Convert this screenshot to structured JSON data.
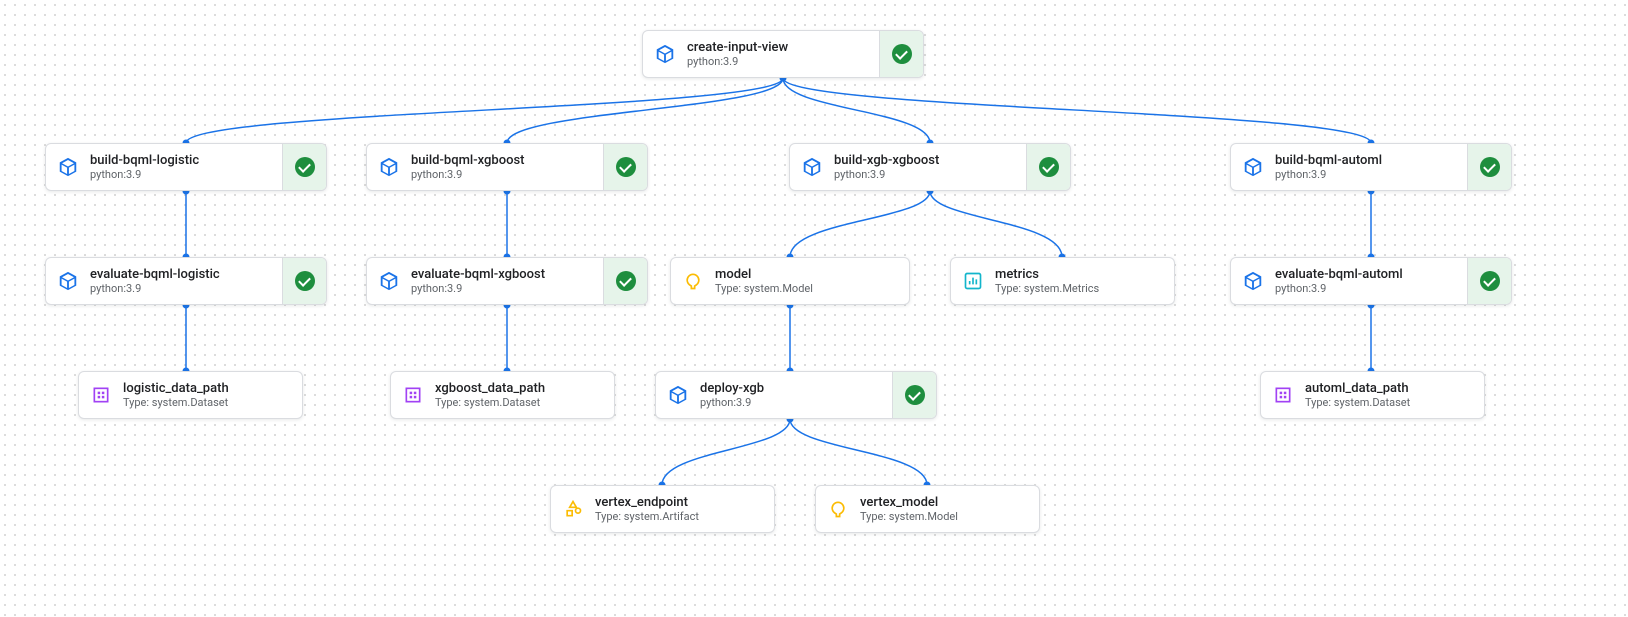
{
  "nodes": {
    "create_input_view": {
      "title": "create-input-view",
      "subtitle": "python:3.9"
    },
    "build_bqml_logistic": {
      "title": "build-bqml-logistic",
      "subtitle": "python:3.9"
    },
    "build_bqml_xgboost": {
      "title": "build-bqml-xgboost",
      "subtitle": "python:3.9"
    },
    "build_xgb_xgboost": {
      "title": "build-xgb-xgboost",
      "subtitle": "python:3.9"
    },
    "build_bqml_automl": {
      "title": "build-bqml-automl",
      "subtitle": "python:3.9"
    },
    "evaluate_bqml_logistic": {
      "title": "evaluate-bqml-logistic",
      "subtitle": "python:3.9"
    },
    "evaluate_bqml_xgboost": {
      "title": "evaluate-bqml-xgboost",
      "subtitle": "python:3.9"
    },
    "evaluate_bqml_automl": {
      "title": "evaluate-bqml-automl",
      "subtitle": "python:3.9"
    },
    "model": {
      "title": "model",
      "subtitle": "Type: system.Model"
    },
    "metrics": {
      "title": "metrics",
      "subtitle": "Type: system.Metrics"
    },
    "deploy_xgb": {
      "title": "deploy-xgb",
      "subtitle": "python:3.9"
    },
    "logistic_data_path": {
      "title": "logistic_data_path",
      "subtitle": "Type: system.Dataset"
    },
    "xgboost_data_path": {
      "title": "xgboost_data_path",
      "subtitle": "Type: system.Dataset"
    },
    "automl_data_path": {
      "title": "automl_data_path",
      "subtitle": "Type: system.Dataset"
    },
    "vertex_endpoint": {
      "title": "vertex_endpoint",
      "subtitle": "Type: system.Artifact"
    },
    "vertex_model": {
      "title": "vertex_model",
      "subtitle": "Type: system.Model"
    }
  }
}
